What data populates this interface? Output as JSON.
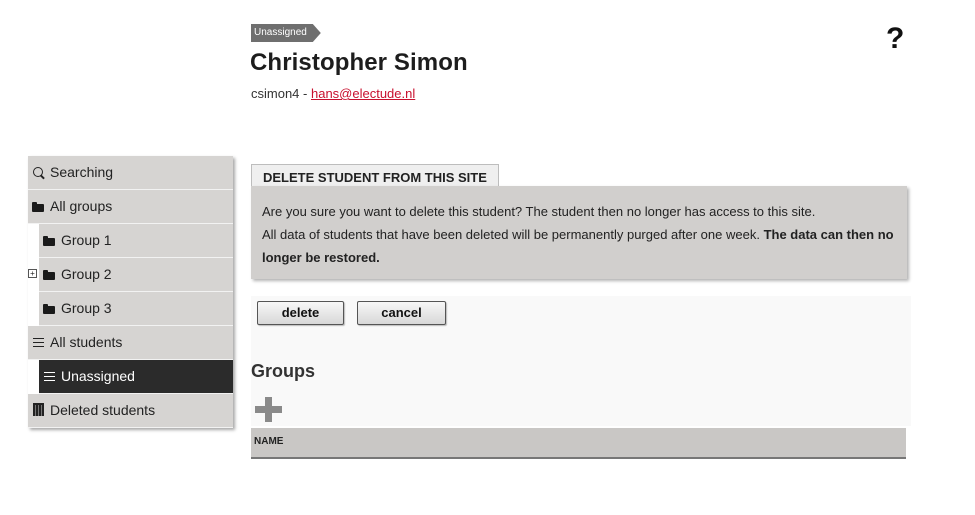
{
  "header": {
    "status_tag": "Unassigned",
    "student_name": "Christopher Simon",
    "username": "csimon4",
    "separator": " - ",
    "email": "hans@electude.nl",
    "help_label": "?"
  },
  "sidebar": {
    "items": [
      {
        "label": "Searching",
        "icon": "search-icon"
      },
      {
        "label": "All groups",
        "icon": "folder-icon"
      },
      {
        "label": "Group 1",
        "icon": "folder-icon"
      },
      {
        "label": "Group 2",
        "icon": "folder-icon",
        "expander": "+"
      },
      {
        "label": "Group 3",
        "icon": "folder-icon"
      },
      {
        "label": "All students",
        "icon": "list-icon"
      },
      {
        "label": "Unassigned",
        "icon": "list-icon",
        "active": true
      },
      {
        "label": "Deleted students",
        "icon": "trash-icon"
      }
    ]
  },
  "delete_panel": {
    "tab_title": "DELETE STUDENT FROM THIS SITE",
    "line1": "Are you sure you want to delete this student? The student then no longer has access to this site.",
    "line2": "All data of students that have been deleted will be permanently purged after one week. ",
    "line2_bold": "The data can then no longer be restored.",
    "delete_label": "delete",
    "cancel_label": "cancel"
  },
  "groups": {
    "title": "Groups",
    "add_icon": "plus-icon",
    "columns": [
      "NAME"
    ]
  },
  "colors": {
    "accent_link": "#c8102e",
    "active_item": "#2b2b2b",
    "panel_bg": "#d1cfcd"
  }
}
